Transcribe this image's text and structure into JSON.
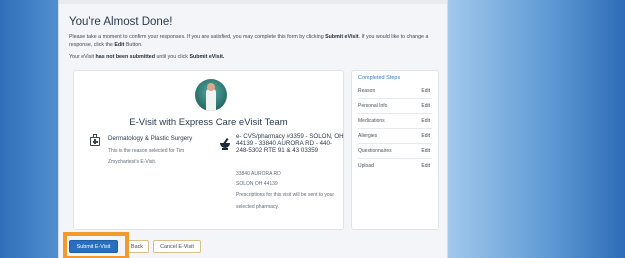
{
  "page": {
    "heading": "You're Almost Done!",
    "intro_line1": "Please take a moment to confirm your responses. If you are satisfied, you may complete this form by clicking",
    "intro_submit": "Submit eVisit",
    "intro_line2": ". If you would like to change a response, click the",
    "intro_edit": "Edit",
    "intro_line3": "Button.",
    "status_prefix": "Your eVisit",
    "status_bold": "has not been submitted",
    "status_mid": "until you click",
    "status_submit": "Submit eVisit."
  },
  "summary": {
    "team_title": "E-Visit with Express Care eVisit Team",
    "reason_title": "Dermatology & Plastic Surgery",
    "reason_note_1": "This is the reason selected for Tim",
    "reason_note_2": "Zmychartest's E-Visit.",
    "pharmacy_name": "e- CVS/pharmacy #3359 - SOLON, OH 44139 - 33840 AURORA RD - 440-248-5302 RTE 91 & 43 03359",
    "pharmacy_address1": "33840 AURORA RD",
    "pharmacy_address2": "SOLON OH 44139",
    "pharmacy_note": "Prescriptions for this visit will be sent to your selected pharmacy."
  },
  "steps": {
    "title": "Completed Steps",
    "items": [
      {
        "label": "Reason",
        "edit": "Edit"
      },
      {
        "label": "Personal Info",
        "edit": "Edit"
      },
      {
        "label": "Medications",
        "edit": "Edit"
      },
      {
        "label": "Allergies",
        "edit": "Edit"
      },
      {
        "label": "Questionnaires",
        "edit": "Edit"
      },
      {
        "label": "Upload",
        "edit": "Edit"
      }
    ]
  },
  "actions": {
    "submit": "Submit E-Visit",
    "back": "Back",
    "cancel": "Cancel E-Visit"
  },
  "colors": {
    "accent": "#2a6fbf",
    "highlight": "#f29a2e",
    "steps_title": "#3b7ac7"
  }
}
